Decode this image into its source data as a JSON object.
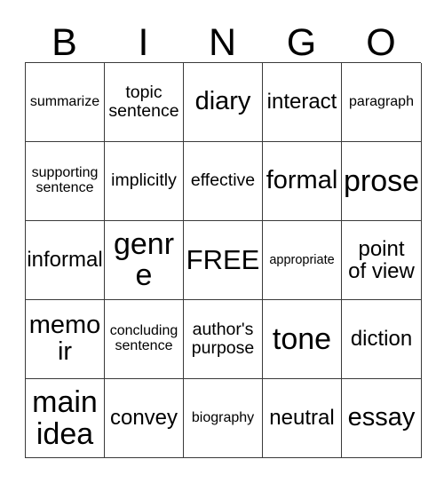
{
  "card": {
    "title": "BINGO",
    "header_letters": [
      "B",
      "I",
      "N",
      "G",
      "O"
    ],
    "columns": 5,
    "rows": 5,
    "free_space_label": "FREE",
    "free_space_position": {
      "row": 3,
      "column": 3
    },
    "border_color": "#3a3a3a",
    "background_color": "#ffffff",
    "text_color": "#000000",
    "cells": [
      [
        {
          "text": "summarize",
          "size": "sm"
        },
        {
          "text": "topic\nsentence",
          "size": "md"
        },
        {
          "text": "diary",
          "size": "xl"
        },
        {
          "text": "interact",
          "size": "lg"
        },
        {
          "text": "paragraph",
          "size": "sm"
        }
      ],
      [
        {
          "text": "supporting\nsentence",
          "size": "sm"
        },
        {
          "text": "implicitly",
          "size": "md"
        },
        {
          "text": "effective",
          "size": "md"
        },
        {
          "text": "formal",
          "size": "xl"
        },
        {
          "text": "prose",
          "size": "xxl"
        }
      ],
      [
        {
          "text": "informal",
          "size": "lg"
        },
        {
          "text": "genre",
          "size": "xxl"
        },
        {
          "text": "FREE",
          "size": "free"
        },
        {
          "text": "appropriate",
          "size": "xs"
        },
        {
          "text": "point\nof view",
          "size": "lg"
        }
      ],
      [
        {
          "text": "memoir",
          "size": "xl"
        },
        {
          "text": "concluding\nsentence",
          "size": "sm"
        },
        {
          "text": "author's\npurpose",
          "size": "md"
        },
        {
          "text": "tone",
          "size": "xxl"
        },
        {
          "text": "diction",
          "size": "lg"
        }
      ],
      [
        {
          "text": "main\nidea",
          "size": "xxl"
        },
        {
          "text": "convey",
          "size": "lg"
        },
        {
          "text": "biography",
          "size": "sm"
        },
        {
          "text": "neutral",
          "size": "lg"
        },
        {
          "text": "essay",
          "size": "xl"
        }
      ]
    ]
  }
}
